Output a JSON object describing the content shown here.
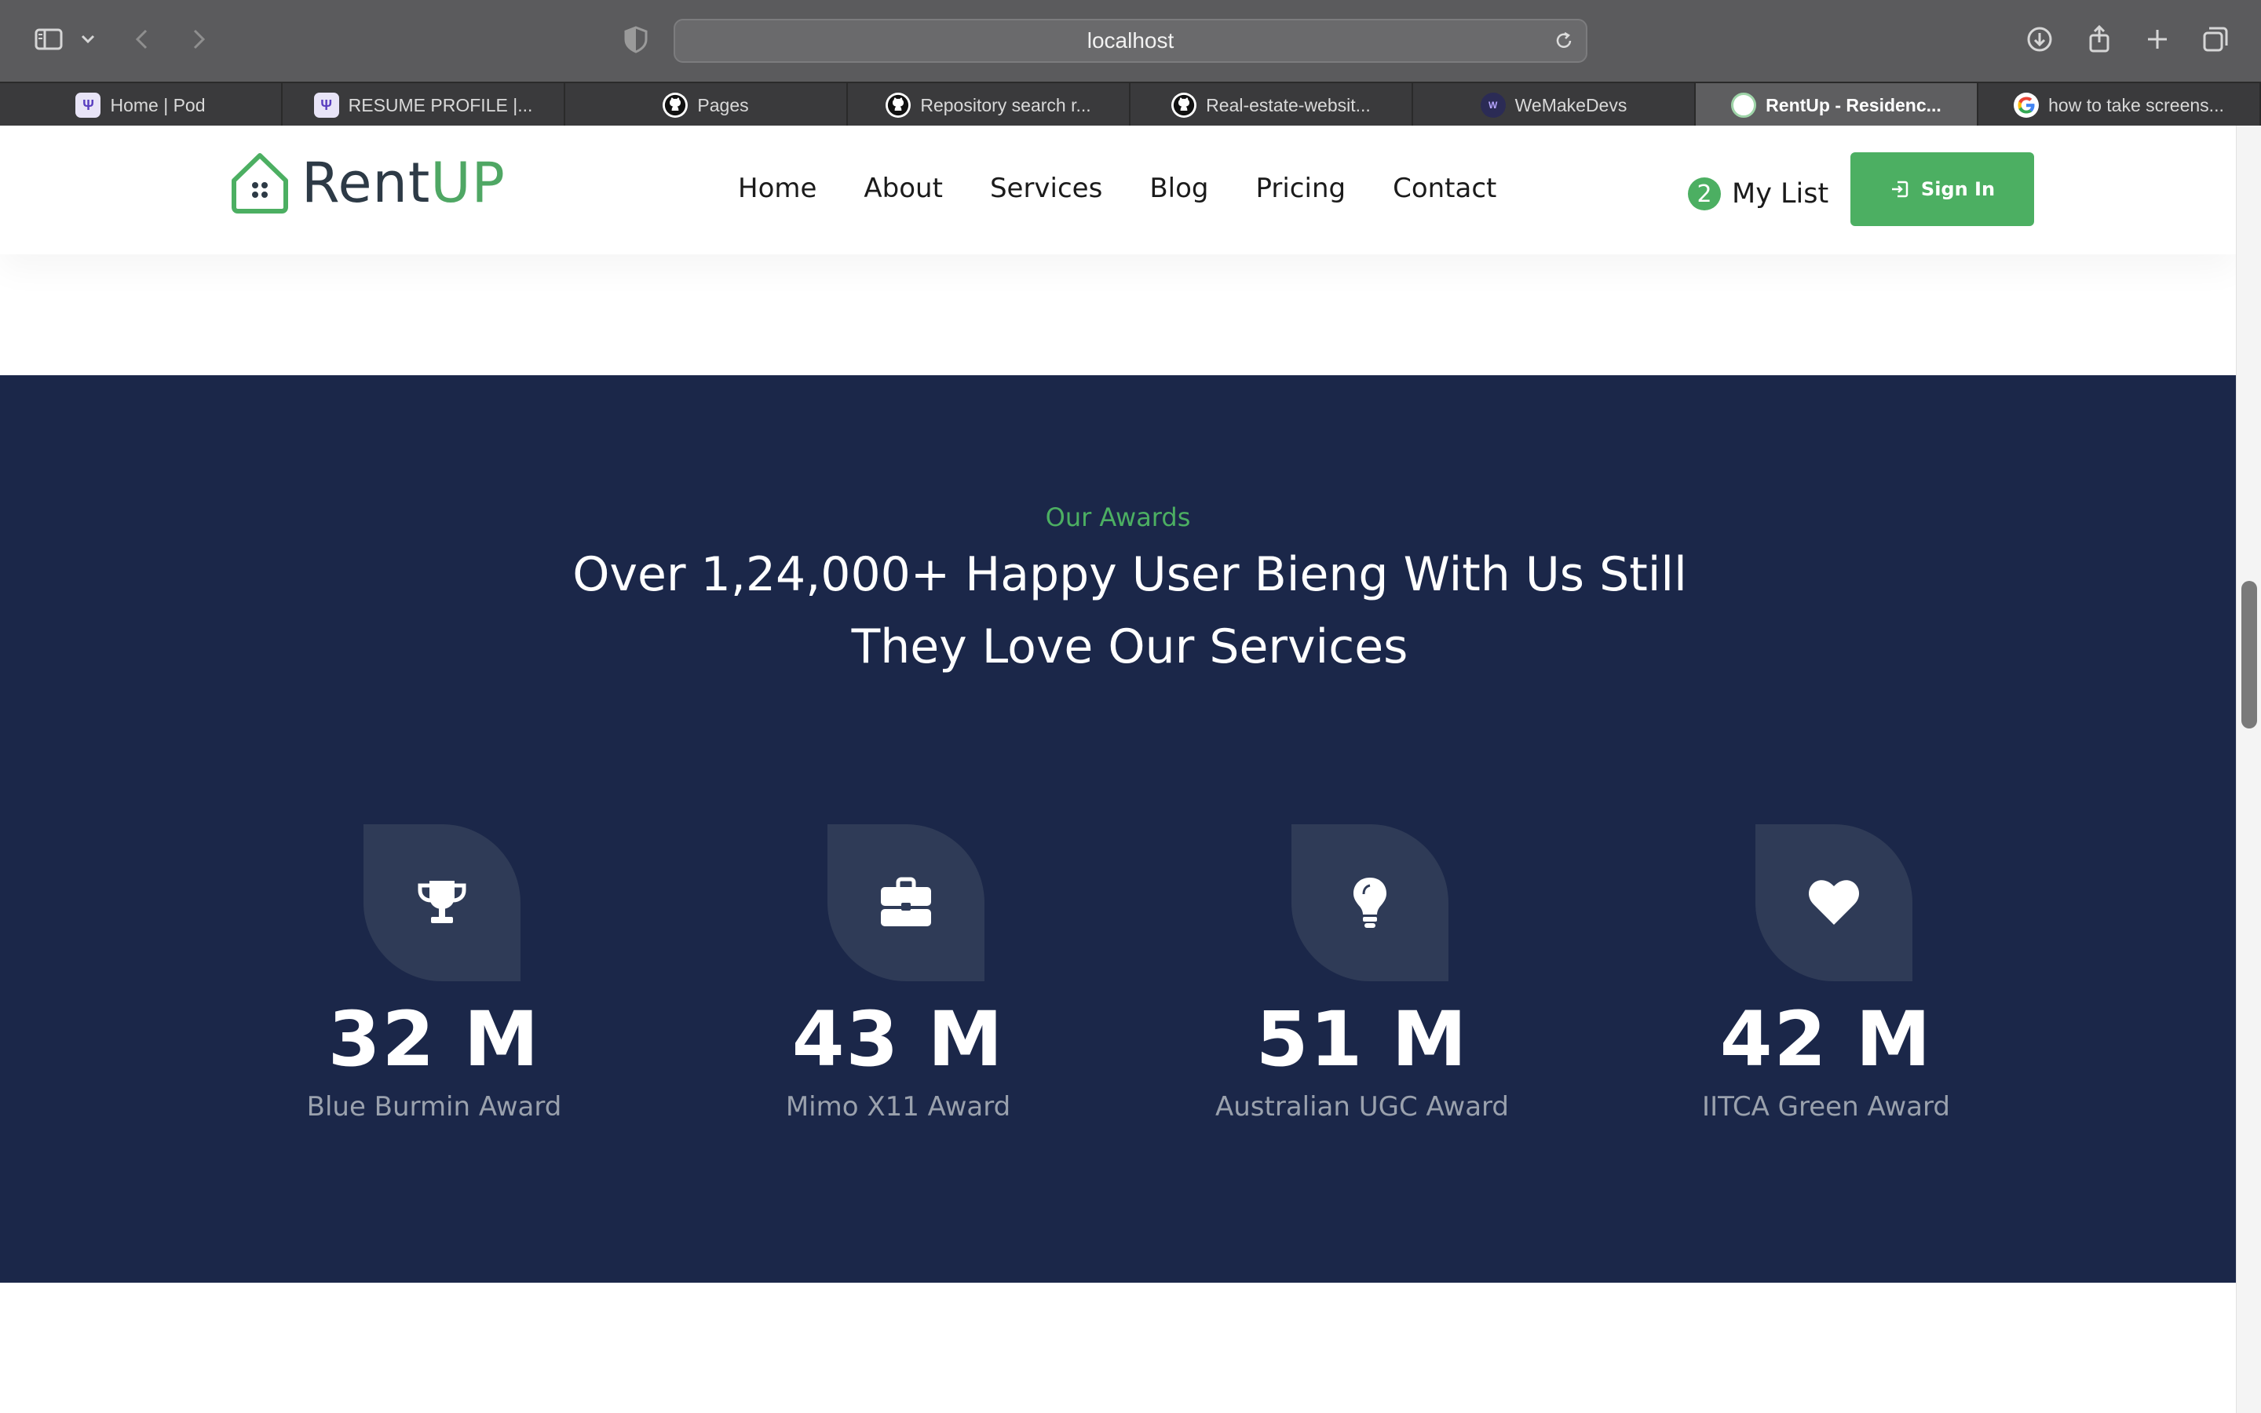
{
  "browser": {
    "url": "localhost",
    "tabs": [
      {
        "title": "Home | Pod",
        "favicon": "pod-logo-icon",
        "active": false
      },
      {
        "title": "RESUME PROFILE |...",
        "favicon": "pod-logo-icon",
        "active": false
      },
      {
        "title": "Pages",
        "favicon": "github-icon",
        "active": false
      },
      {
        "title": "Repository search r...",
        "favicon": "github-icon",
        "active": false
      },
      {
        "title": "Real-estate-websit...",
        "favicon": "github-icon",
        "active": false
      },
      {
        "title": "WeMakeDevs",
        "favicon": "wemakedevs-icon",
        "active": false
      },
      {
        "title": "RentUp - Residenc...",
        "favicon": "rentup-icon",
        "active": true
      },
      {
        "title": "how to take screens...",
        "favicon": "google-icon",
        "active": false
      }
    ]
  },
  "nav": {
    "logo_rent": "Rent",
    "logo_up": "UP",
    "links": [
      "Home",
      "About",
      "Services",
      "Blog",
      "Pricing",
      "Contact"
    ],
    "mylist_count": "2",
    "mylist_label": "My List",
    "signin_label": "Sign In"
  },
  "awards": {
    "eyebrow": "Our Awards",
    "headline_line1": "Over 1,24,000+ Happy User Bieng With Us Still",
    "headline_line2": "They Love Our Services",
    "items": [
      {
        "icon": "trophy-icon",
        "value": "32 M",
        "label": "Blue Burmin Award"
      },
      {
        "icon": "briefcase-icon",
        "value": "43 M",
        "label": "Mimo X11 Award"
      },
      {
        "icon": "lightbulb-icon",
        "value": "51 M",
        "label": "Australian UGC Award"
      },
      {
        "icon": "heart-icon",
        "value": "42 M",
        "label": "IITCA Green Award"
      }
    ]
  },
  "colors": {
    "brand_green": "#4caf62",
    "section_bg": "#1b2749",
    "icon_box": "#2f3b57",
    "award_label": "#9aa1ad"
  }
}
